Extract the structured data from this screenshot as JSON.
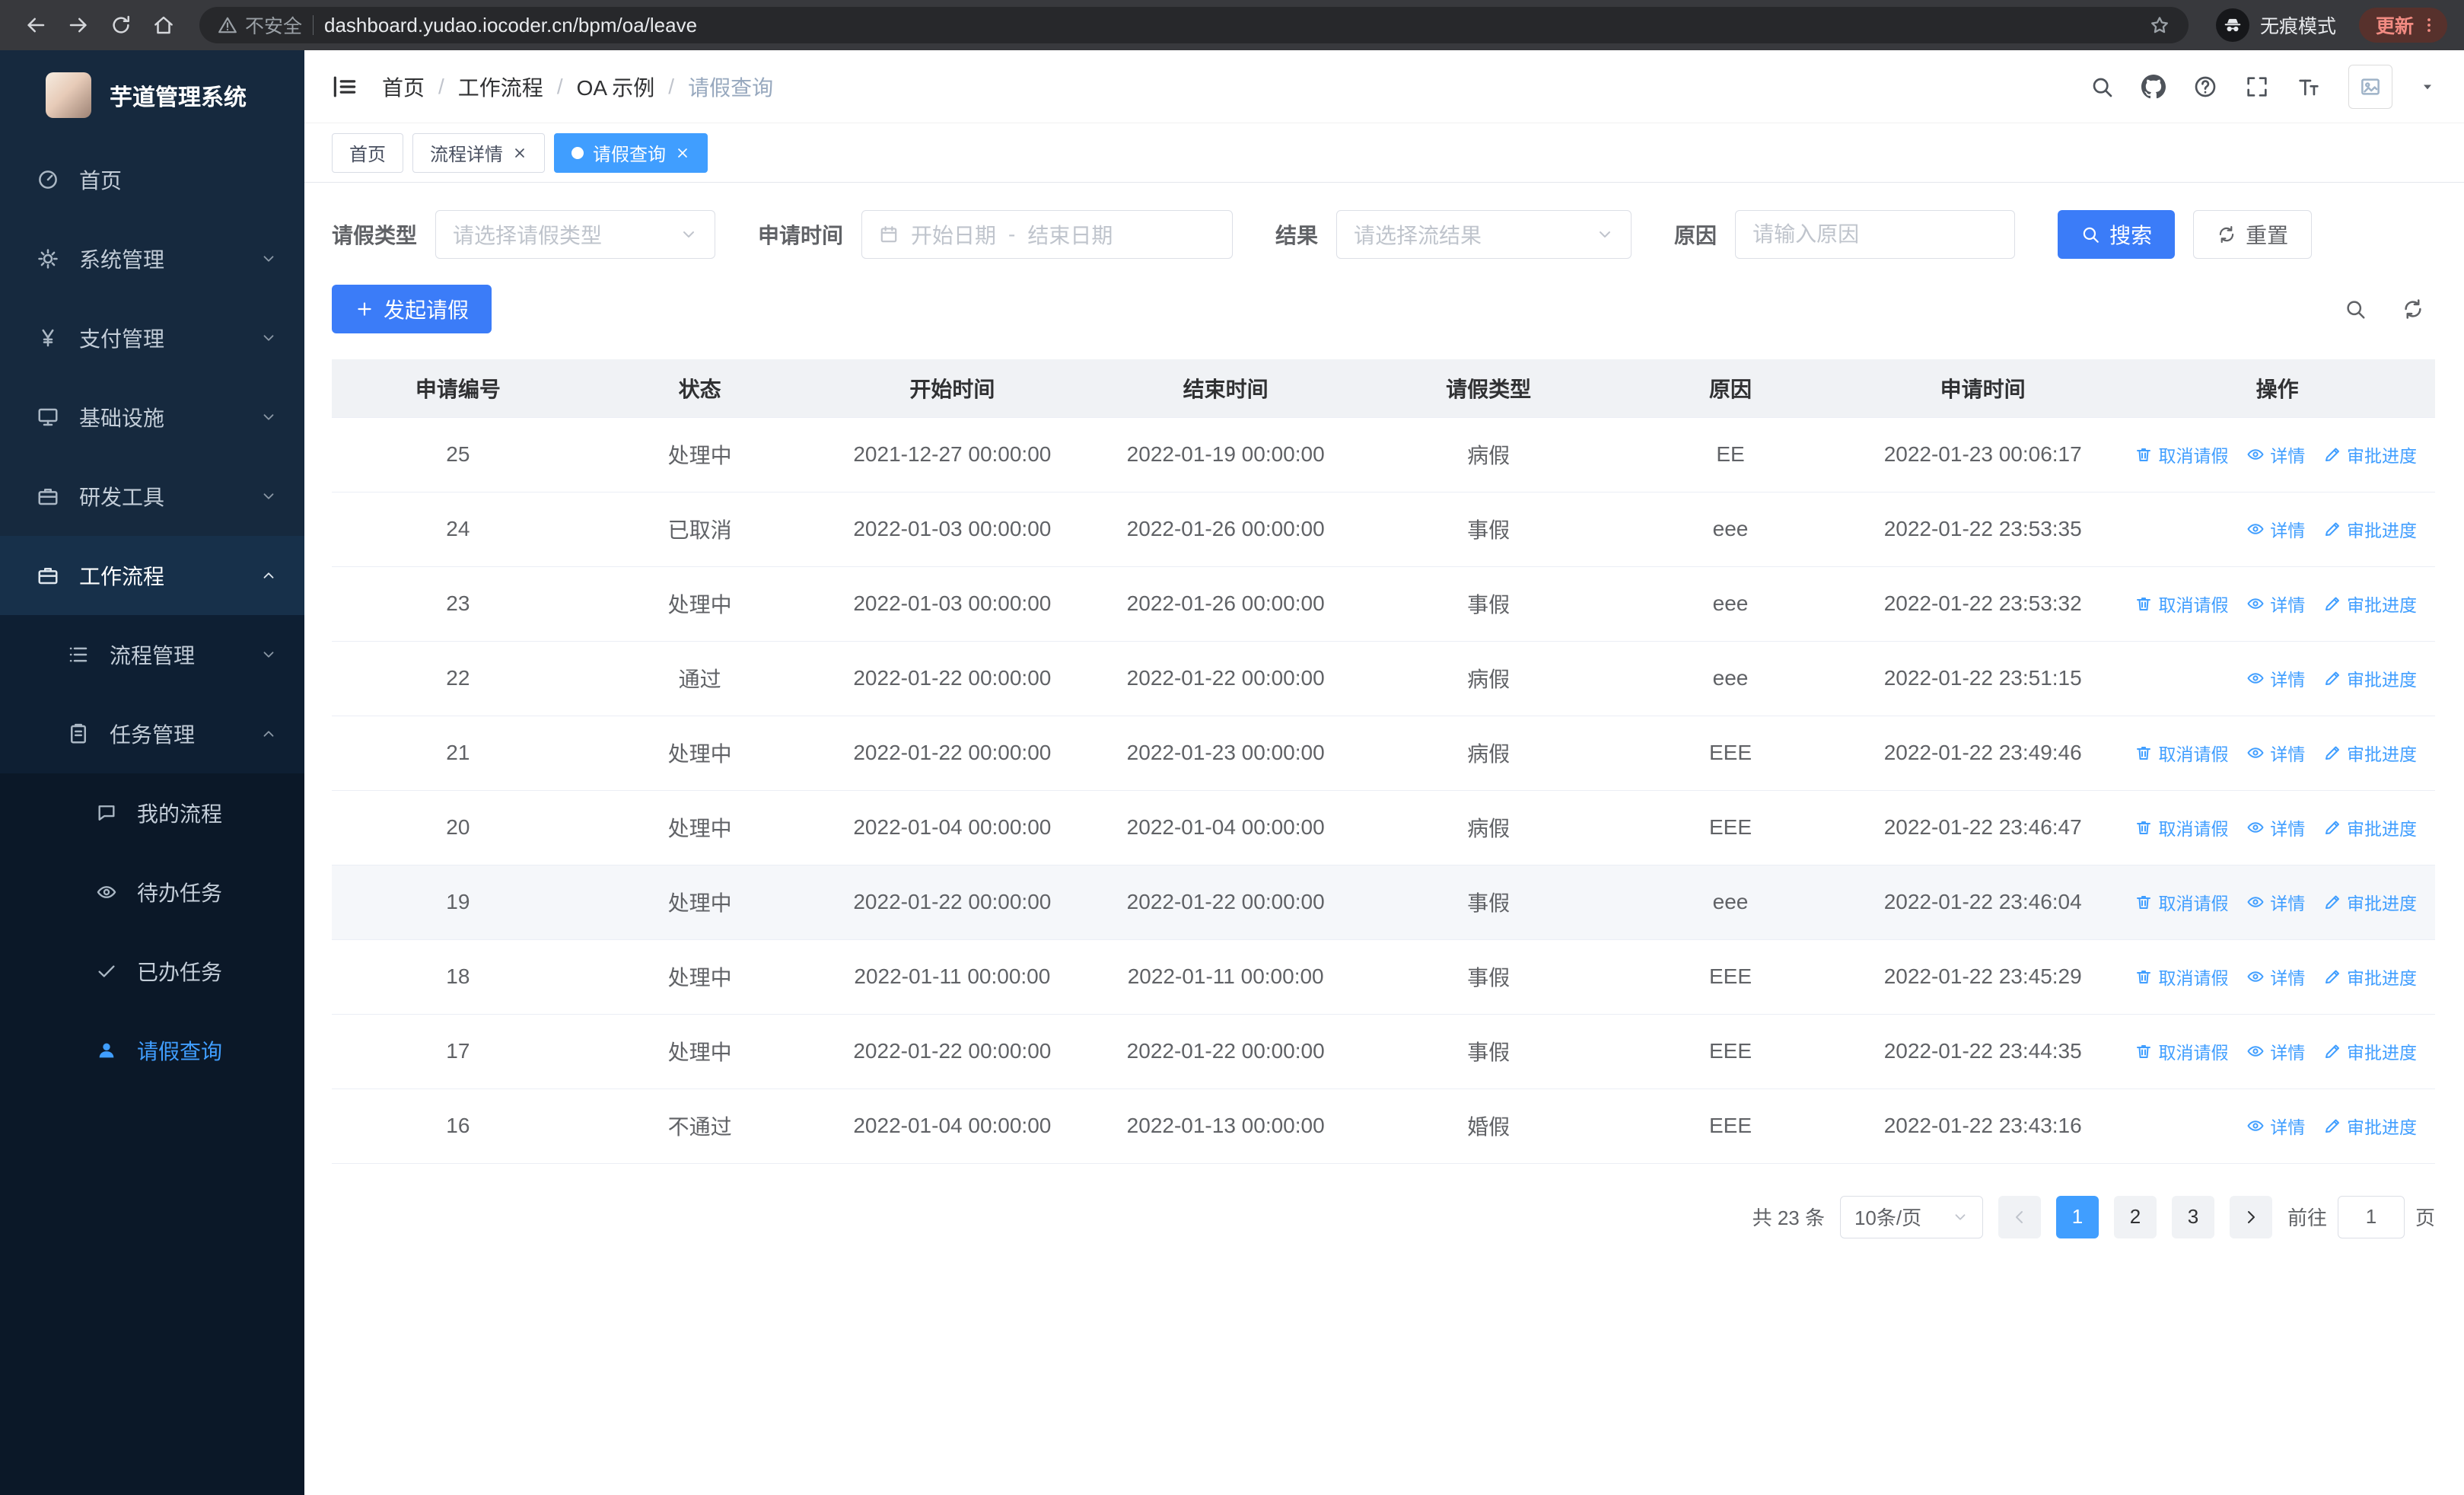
{
  "colors": {
    "primary_button": "#3b7cf8",
    "link_blue": "#409eff",
    "active_tab": "#409eff",
    "sidebar_bg": "#0e1f33",
    "sidebar_active_text": "#409eff",
    "table_header_bg": "#f0f2f5",
    "chrome_bg": "#38393d",
    "update_pill_text": "#f28b82"
  },
  "browser": {
    "security_label": "不安全",
    "url": "dashboard.yudao.iocoder.cn/bpm/oa/leave",
    "incognito_label": "无痕模式",
    "update_label": "更新"
  },
  "sidebar": {
    "logo_title": "芋道管理系统",
    "menu": [
      {
        "label": "首页"
      },
      {
        "label": "系统管理"
      },
      {
        "label": "支付管理"
      },
      {
        "label": "基础设施"
      },
      {
        "label": "研发工具"
      },
      {
        "label": "工作流程"
      },
      {
        "label": "流程管理"
      },
      {
        "label": "任务管理"
      },
      {
        "label": "我的流程"
      },
      {
        "label": "待办任务"
      },
      {
        "label": "已办任务"
      },
      {
        "label": "请假查询"
      }
    ]
  },
  "breadcrumb": [
    "首页",
    "工作流程",
    "OA 示例",
    "请假查询"
  ],
  "tabs": [
    {
      "label": "首页"
    },
    {
      "label": "流程详情"
    },
    {
      "label": "请假查询"
    }
  ],
  "filters": {
    "type_label": "请假类型",
    "type_placeholder": "请选择请假类型",
    "time_label": "申请时间",
    "start_placeholder": "开始日期",
    "range_separator": "-",
    "end_placeholder": "结束日期",
    "result_label": "结果",
    "result_placeholder": "请选择流结果",
    "reason_label": "原因",
    "reason_placeholder": "请输入原因",
    "search_button": "搜索",
    "reset_button": "重置"
  },
  "toolbar": {
    "create_button": "发起请假"
  },
  "table": {
    "columns": [
      "申请编号",
      "状态",
      "开始时间",
      "结束时间",
      "请假类型",
      "原因",
      "申请时间",
      "操作"
    ],
    "rows": [
      {
        "id": "25",
        "status": "处理中",
        "start": "2021-12-27 00:00:00",
        "end": "2022-01-19 00:00:00",
        "type": "病假",
        "reason": "EE",
        "applied": "2022-01-23 00:06:17",
        "actions": [
          "取消请假",
          "详情",
          "审批进度"
        ]
      },
      {
        "id": "24",
        "status": "已取消",
        "start": "2022-01-03 00:00:00",
        "end": "2022-01-26 00:00:00",
        "type": "事假",
        "reason": "eee",
        "applied": "2022-01-22 23:53:35",
        "actions": [
          "详情",
          "审批进度"
        ]
      },
      {
        "id": "23",
        "status": "处理中",
        "start": "2022-01-03 00:00:00",
        "end": "2022-01-26 00:00:00",
        "type": "事假",
        "reason": "eee",
        "applied": "2022-01-22 23:53:32",
        "actions": [
          "取消请假",
          "详情",
          "审批进度"
        ]
      },
      {
        "id": "22",
        "status": "通过",
        "start": "2022-01-22 00:00:00",
        "end": "2022-01-22 00:00:00",
        "type": "病假",
        "reason": "eee",
        "applied": "2022-01-22 23:51:15",
        "actions": [
          "详情",
          "审批进度"
        ]
      },
      {
        "id": "21",
        "status": "处理中",
        "start": "2022-01-22 00:00:00",
        "end": "2022-01-23 00:00:00",
        "type": "病假",
        "reason": "EEE",
        "applied": "2022-01-22 23:49:46",
        "actions": [
          "取消请假",
          "详情",
          "审批进度"
        ]
      },
      {
        "id": "20",
        "status": "处理中",
        "start": "2022-01-04 00:00:00",
        "end": "2022-01-04 00:00:00",
        "type": "病假",
        "reason": "EEE",
        "applied": "2022-01-22 23:46:47",
        "actions": [
          "取消请假",
          "详情",
          "审批进度"
        ]
      },
      {
        "id": "19",
        "status": "处理中",
        "start": "2022-01-22 00:00:00",
        "end": "2022-01-22 00:00:00",
        "type": "事假",
        "reason": "eee",
        "applied": "2022-01-22 23:46:04",
        "actions": [
          "取消请假",
          "详情",
          "审批进度"
        ]
      },
      {
        "id": "18",
        "status": "处理中",
        "start": "2022-01-11 00:00:00",
        "end": "2022-01-11 00:00:00",
        "type": "事假",
        "reason": "EEE",
        "applied": "2022-01-22 23:45:29",
        "actions": [
          "取消请假",
          "详情",
          "审批进度"
        ]
      },
      {
        "id": "17",
        "status": "处理中",
        "start": "2022-01-22 00:00:00",
        "end": "2022-01-22 00:00:00",
        "type": "事假",
        "reason": "EEE",
        "applied": "2022-01-22 23:44:35",
        "actions": [
          "取消请假",
          "详情",
          "审批进度"
        ]
      },
      {
        "id": "16",
        "status": "不通过",
        "start": "2022-01-04 00:00:00",
        "end": "2022-01-13 00:00:00",
        "type": "婚假",
        "reason": "EEE",
        "applied": "2022-01-22 23:43:16",
        "actions": [
          "详情",
          "审批进度"
        ]
      }
    ]
  },
  "pagination": {
    "total": "共 23 条",
    "page_size": "10条/页",
    "pages": [
      "1",
      "2",
      "3"
    ],
    "goto_label": "前往",
    "goto_value": "1",
    "page_label": "页"
  }
}
